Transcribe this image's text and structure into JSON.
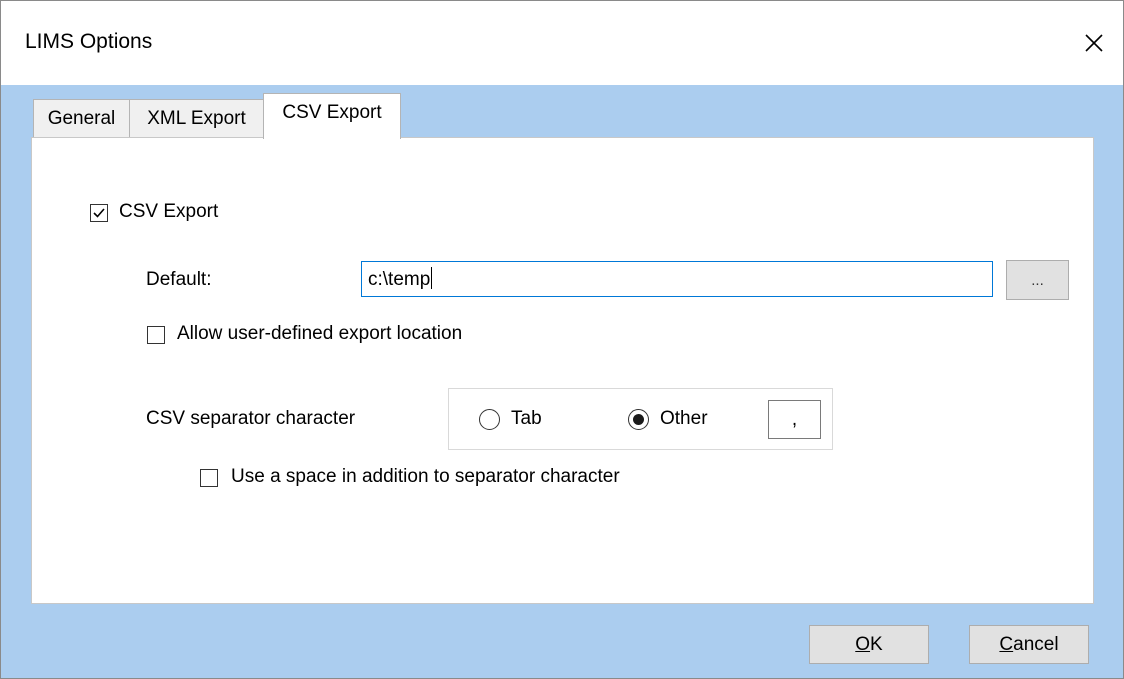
{
  "window": {
    "title": "LIMS Options"
  },
  "tabs": [
    {
      "label": "General",
      "active": false
    },
    {
      "label": "XML Export",
      "active": false
    },
    {
      "label": "CSV Export",
      "active": true
    }
  ],
  "csv_export": {
    "enable_checkbox": {
      "label": "CSV Export",
      "checked": true
    },
    "default_label": "Default:",
    "default_value": "c:\\temp",
    "browse_label": "...",
    "allow_user_location": {
      "label": "Allow user-defined export location",
      "checked": false
    },
    "separator_label": "CSV separator character",
    "separator_options": {
      "tab": {
        "label": "Tab",
        "selected": false
      },
      "other": {
        "label": "Other",
        "selected": true
      }
    },
    "other_value": ",",
    "use_space": {
      "label": "Use a space in addition to separator character",
      "checked": false
    }
  },
  "buttons": {
    "ok_mnemonic": "O",
    "ok_rest": "K",
    "cancel_mnemonic": "C",
    "cancel_rest": "ancel"
  },
  "colors": {
    "dialog_background": "#abcdef",
    "input_focus_border": "#0078d7"
  },
  "icons": {
    "close": "close-icon",
    "check": "checkmark-icon"
  }
}
